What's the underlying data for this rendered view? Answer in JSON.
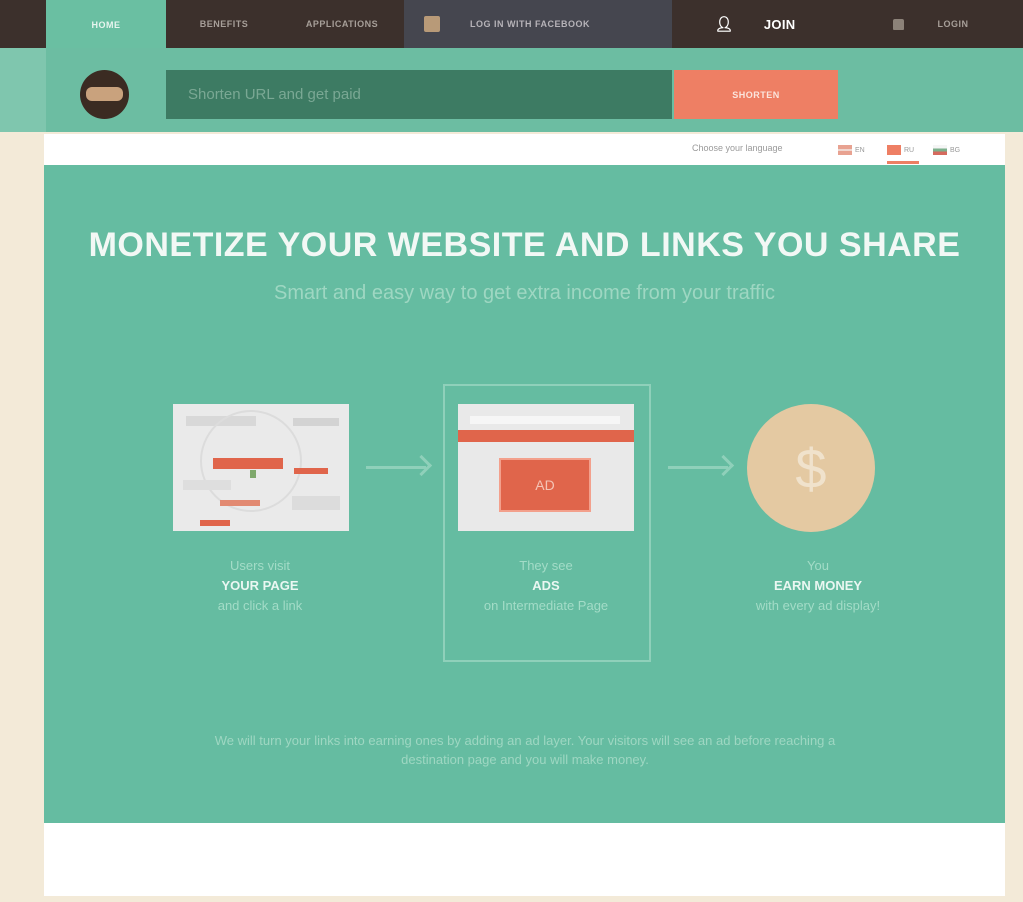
{
  "nav": {
    "home": "HOME",
    "benefits": "BENEFITS",
    "applications": "APPLICATIONS",
    "facebook_login": "LOG IN WITH FACEBOOK",
    "join": "JOIN",
    "login": "LOGIN"
  },
  "shortener": {
    "placeholder": "Shorten URL and get paid",
    "button": "SHORTEN"
  },
  "language": {
    "label": "Choose your language",
    "options": [
      "EN",
      "RU",
      "BG"
    ],
    "selected": "RU"
  },
  "hero": {
    "title": "MONETIZE YOUR WEBSITE AND LINKS YOU SHARE",
    "subtitle": "Smart and easy way to get extra income from your traffic",
    "steps": [
      {
        "line1": "Users visit",
        "bold": "YOUR PAGE",
        "line2": "and click a link"
      },
      {
        "line1": "They see",
        "bold": "ADS",
        "line2": "on Intermediate Page"
      },
      {
        "line1": "You",
        "bold": "EARN MONEY",
        "line2": "with every ad display!"
      }
    ],
    "ad_label": "AD",
    "coin_symbol": "$",
    "description": "We will turn your links into earning ones by adding an ad layer. Your visitors will see an ad before reaching a destination page and you will make money."
  },
  "colors": {
    "nav_bg": "#3c302c",
    "accent_green": "#65bca1",
    "accent_orange": "#ee7f64",
    "input_dark": "#3d7b63"
  }
}
